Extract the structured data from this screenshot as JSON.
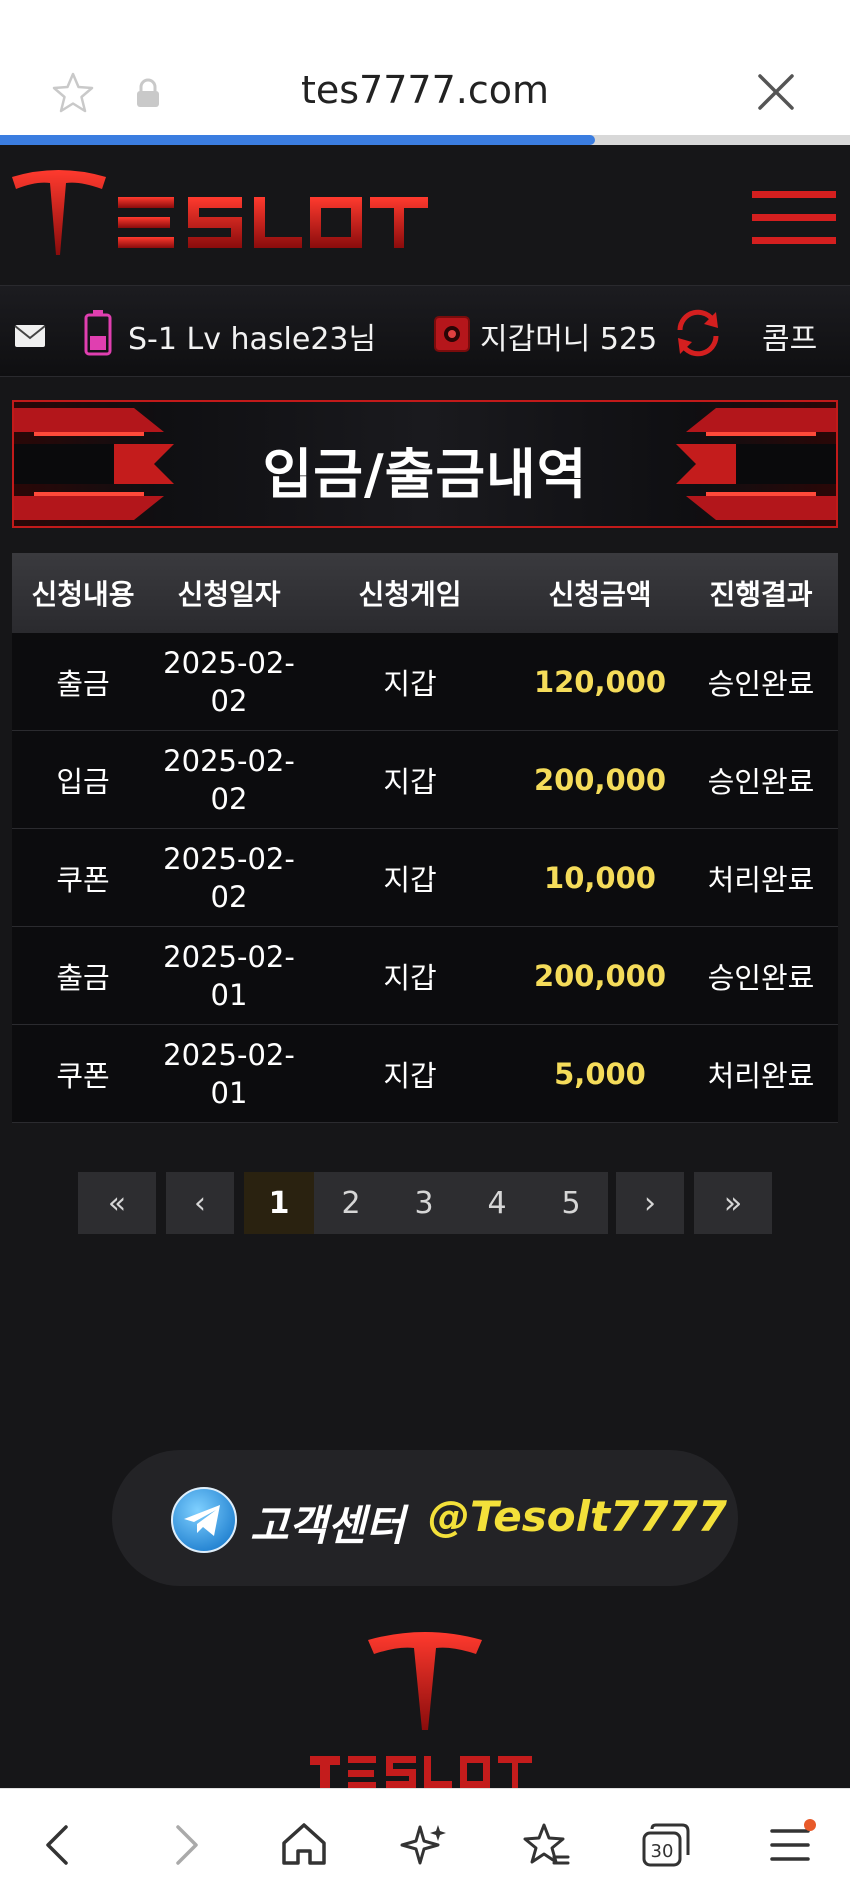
{
  "browser": {
    "url": "tes7777.com",
    "load_progress_percent": 70
  },
  "site": {
    "brand": "TESLOT",
    "accent_color": "#d41f1f"
  },
  "user_bar": {
    "user_info": "S-1 Lv hasle23님",
    "wallet_label": "지갑머니 525",
    "comp_label": "콤프"
  },
  "page": {
    "title": "입금/출금내역"
  },
  "table": {
    "headers": [
      "신청내용",
      "신청일자",
      "신청게임",
      "신청금액",
      "진행결과"
    ],
    "rows": [
      {
        "type": "출금",
        "date_line1": "2025-02-",
        "date_line2": "02",
        "game": "지갑",
        "amount": "120,000",
        "result": "승인완료"
      },
      {
        "type": "입금",
        "date_line1": "2025-02-",
        "date_line2": "02",
        "game": "지갑",
        "amount": "200,000",
        "result": "승인완료"
      },
      {
        "type": "쿠폰",
        "date_line1": "2025-02-",
        "date_line2": "02",
        "game": "지갑",
        "amount": "10,000",
        "result": "처리완료"
      },
      {
        "type": "출금",
        "date_line1": "2025-02-",
        "date_line2": "01",
        "game": "지갑",
        "amount": "200,000",
        "result": "승인완료"
      },
      {
        "type": "쿠폰",
        "date_line1": "2025-02-",
        "date_line2": "01",
        "game": "지갑",
        "amount": "5,000",
        "result": "처리완료"
      }
    ]
  },
  "pagination": {
    "first": "«",
    "prev": "‹",
    "pages": [
      "1",
      "2",
      "3",
      "4",
      "5"
    ],
    "current": "1",
    "next": "›",
    "last": "»"
  },
  "support": {
    "label": "고객센터",
    "handle": "@Tesolt7777"
  },
  "bottom_nav": {
    "tab_count": "30",
    "icons": [
      "back-icon",
      "forward-icon",
      "home-icon",
      "sparkle-icon",
      "bookmarks-icon",
      "tabs-icon",
      "menu-icon"
    ]
  }
}
